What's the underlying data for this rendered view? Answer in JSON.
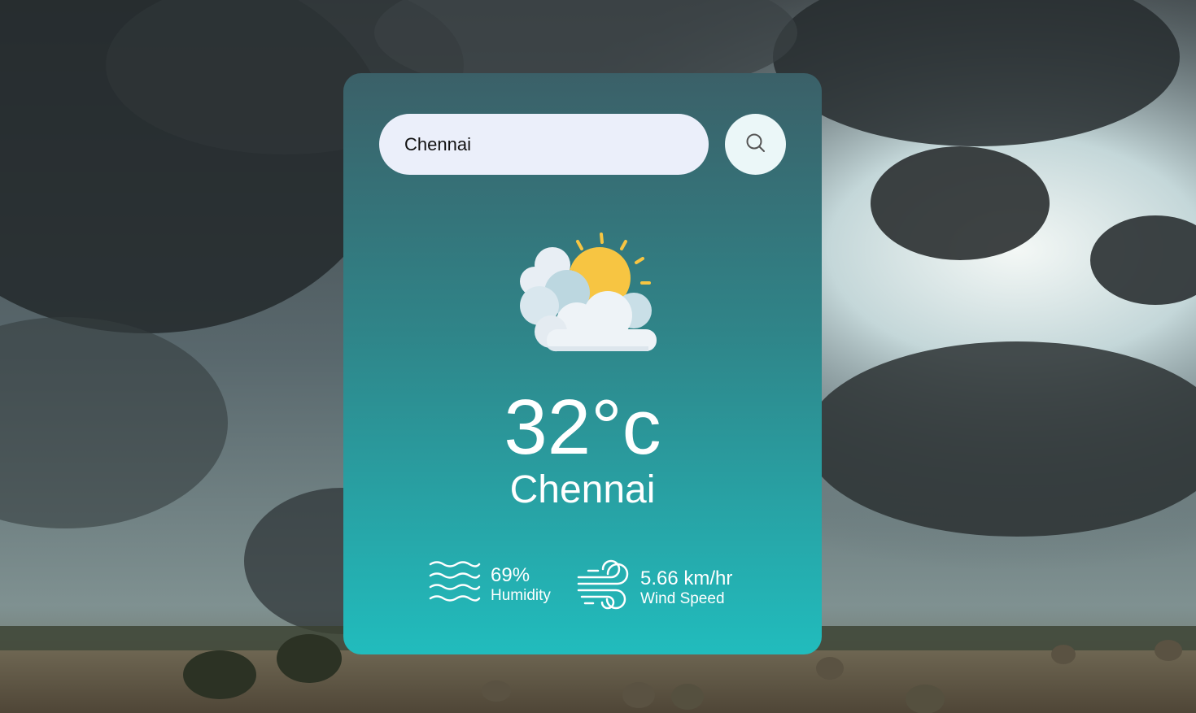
{
  "search": {
    "value": "Chennai",
    "button_icon": "search-icon"
  },
  "weather": {
    "condition_icon": "partly-cloudy-icon",
    "temperature": "32°c",
    "city": "Chennai"
  },
  "details": {
    "humidity": {
      "icon": "humidity-icon",
      "value": "69%",
      "label": "Humidity"
    },
    "wind": {
      "icon": "wind-icon",
      "value": "5.66 km/hr",
      "label": "Wind Speed"
    }
  },
  "colors": {
    "card_top": "#3b6068",
    "card_bottom": "#21bcbd",
    "input_bg": "#ebeffa",
    "text": "#ffffff",
    "sun": "#f7c542",
    "cloud": "#eef3f7"
  }
}
